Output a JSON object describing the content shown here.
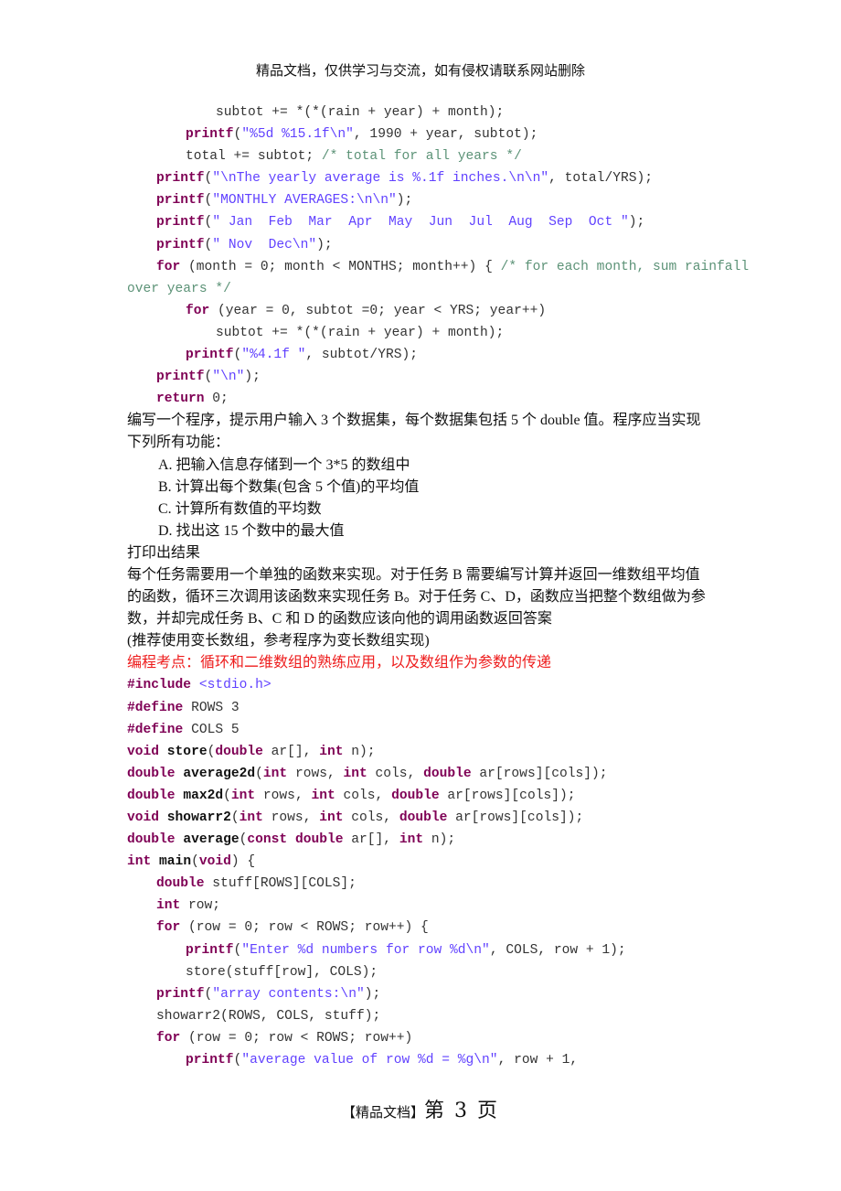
{
  "header": {
    "text": "精品文档，仅供学习与交流，如有侵权请联系网站删除"
  },
  "footer": {
    "tag": "【精品文档】",
    "page_label": "第 3 页"
  },
  "code_block_1": [
    {
      "indent": 3,
      "tokens": [
        [
          "pl",
          "subtot += *(*(rain + year) + month);"
        ]
      ]
    },
    {
      "indent": 2,
      "tokens": [
        [
          "kw",
          "printf"
        ],
        [
          "pl",
          "("
        ],
        [
          "str",
          "\"%5d %15.1f\\n\""
        ],
        [
          "pl",
          ", 1990 + year, subtot);"
        ]
      ]
    },
    {
      "indent": 2,
      "tokens": [
        [
          "pl",
          "total += subtot; "
        ],
        [
          "cm",
          "/* total for all years */"
        ]
      ]
    },
    {
      "indent": 1,
      "tokens": [
        [
          "kw",
          "printf"
        ],
        [
          "pl",
          "("
        ],
        [
          "str",
          "\"\\nThe yearly average is %.1f inches.\\n\\n\""
        ],
        [
          "pl",
          ", total/YRS);"
        ]
      ]
    },
    {
      "indent": 1,
      "tokens": [
        [
          "kw",
          "printf"
        ],
        [
          "pl",
          "("
        ],
        [
          "str",
          "\"MONTHLY AVERAGES:\\n\\n\""
        ],
        [
          "pl",
          ");"
        ]
      ]
    },
    {
      "indent": 1,
      "tokens": [
        [
          "kw",
          "printf"
        ],
        [
          "pl",
          "("
        ],
        [
          "str",
          "\" Jan  Feb  Mar  Apr  May  Jun  Jul  Aug  Sep  Oct \""
        ],
        [
          "pl",
          ");"
        ]
      ]
    },
    {
      "indent": 1,
      "tokens": [
        [
          "kw",
          "printf"
        ],
        [
          "pl",
          "("
        ],
        [
          "str",
          "\" Nov  Dec\\n\""
        ],
        [
          "pl",
          ");"
        ]
      ]
    },
    {
      "indent": 1,
      "tokens": [
        [
          "kw",
          "for"
        ],
        [
          "pl",
          " (month = 0; month < MONTHS; month++) { "
        ],
        [
          "cm",
          "/* for each month, sum rainfall"
        ]
      ]
    },
    {
      "indent": 0,
      "tokens": [
        [
          "cm",
          "over years */"
        ]
      ]
    },
    {
      "indent": 2,
      "tokens": [
        [
          "kw",
          "for"
        ],
        [
          "pl",
          " (year = 0, subtot =0; year < YRS; year++)"
        ]
      ]
    },
    {
      "indent": 3,
      "tokens": [
        [
          "pl",
          "subtot += *(*(rain + year) + month);"
        ]
      ]
    },
    {
      "indent": 2,
      "tokens": [
        [
          "kw",
          "printf"
        ],
        [
          "pl",
          "("
        ],
        [
          "str",
          "\"%4.1f \""
        ],
        [
          "pl",
          ", subtot/YRS);"
        ]
      ]
    },
    {
      "indent": 1,
      "tokens": [
        [
          "kw",
          "printf"
        ],
        [
          "pl",
          "("
        ],
        [
          "str",
          "\"\\n\""
        ],
        [
          "pl",
          ");"
        ]
      ]
    },
    {
      "indent": 1,
      "tokens": [
        [
          "kw",
          "return"
        ],
        [
          "pl",
          " 0;"
        ]
      ]
    }
  ],
  "task": {
    "intro_line1": "编写一个程序，提示用户输入 3 个数据集，每个数据集包括 5 个 double 值。程序应当实现",
    "intro_line2": "下列所有功能：",
    "items": [
      "A.   把输入信息存储到一个 3*5 的数组中",
      "B.  计算出每个数集(包含 5 个值)的平均值",
      "C.  计算所有数值的平均数",
      "D.   找出这 15 个数中的最大值"
    ],
    "print_result": "打印出结果",
    "desc_lines": [
      "每个任务需要用一个单独的函数来实现。对于任务 B 需要编写计算并返回一维数组平均值",
      "的函数，循环三次调用该函数来实现任务 B。对于任务 C、D，函数应当把整个数组做为参",
      "数，并却完成任务 B、C 和 D 的函数应该向他的调用函数返回答案",
      "(推荐使用变长数组，参考程序为变长数组实现)"
    ],
    "exam_point": "编程考点：循环和二维数组的熟练应用，以及数组作为参数的传递"
  },
  "code_block_2": [
    {
      "indent": 0,
      "tokens": [
        [
          "kw",
          "#include"
        ],
        [
          "pl",
          " "
        ],
        [
          "str",
          "<stdio.h>"
        ]
      ]
    },
    {
      "indent": 0,
      "tokens": [
        [
          "kw",
          "#define"
        ],
        [
          "pl",
          " ROWS 3"
        ]
      ]
    },
    {
      "indent": 0,
      "tokens": [
        [
          "kw",
          "#define"
        ],
        [
          "pl",
          " COLS 5"
        ]
      ]
    },
    {
      "indent": 0,
      "tokens": [
        [
          "kw",
          "void"
        ],
        [
          "pl",
          " "
        ],
        [
          "fn",
          "store"
        ],
        [
          "pl",
          "("
        ],
        [
          "kw",
          "double"
        ],
        [
          "pl",
          " ar[], "
        ],
        [
          "kw",
          "int"
        ],
        [
          "pl",
          " n);"
        ]
      ]
    },
    {
      "indent": 0,
      "tokens": [
        [
          "kw",
          "double"
        ],
        [
          "pl",
          " "
        ],
        [
          "fn",
          "average2d"
        ],
        [
          "pl",
          "("
        ],
        [
          "kw",
          "int"
        ],
        [
          "pl",
          " rows, "
        ],
        [
          "kw",
          "int"
        ],
        [
          "pl",
          " cols, "
        ],
        [
          "kw",
          "double"
        ],
        [
          "pl",
          " ar[rows][cols]);"
        ]
      ]
    },
    {
      "indent": 0,
      "tokens": [
        [
          "kw",
          "double"
        ],
        [
          "pl",
          " "
        ],
        [
          "fn",
          "max2d"
        ],
        [
          "pl",
          "("
        ],
        [
          "kw",
          "int"
        ],
        [
          "pl",
          " rows, "
        ],
        [
          "kw",
          "int"
        ],
        [
          "pl",
          " cols, "
        ],
        [
          "kw",
          "double"
        ],
        [
          "pl",
          " ar[rows][cols]);"
        ]
      ]
    },
    {
      "indent": 0,
      "tokens": [
        [
          "kw",
          "void"
        ],
        [
          "pl",
          " "
        ],
        [
          "fn",
          "showarr2"
        ],
        [
          "pl",
          "("
        ],
        [
          "kw",
          "int"
        ],
        [
          "pl",
          " rows, "
        ],
        [
          "kw",
          "int"
        ],
        [
          "pl",
          " cols, "
        ],
        [
          "kw",
          "double"
        ],
        [
          "pl",
          " ar[rows][cols]);"
        ]
      ]
    },
    {
      "indent": 0,
      "tokens": [
        [
          "kw",
          "double"
        ],
        [
          "pl",
          " "
        ],
        [
          "fn",
          "average"
        ],
        [
          "pl",
          "("
        ],
        [
          "kw",
          "const"
        ],
        [
          "pl",
          " "
        ],
        [
          "kw",
          "double"
        ],
        [
          "pl",
          " ar[], "
        ],
        [
          "kw",
          "int"
        ],
        [
          "pl",
          " n);"
        ]
      ]
    },
    {
      "indent": 0,
      "tokens": [
        [
          "kw",
          "int"
        ],
        [
          "pl",
          " "
        ],
        [
          "fn",
          "main"
        ],
        [
          "pl",
          "("
        ],
        [
          "kw",
          "void"
        ],
        [
          "pl",
          ") {"
        ]
      ]
    },
    {
      "indent": 1,
      "tokens": [
        [
          "kw",
          "double"
        ],
        [
          "pl",
          " stuff[ROWS][COLS];"
        ]
      ]
    },
    {
      "indent": 1,
      "tokens": [
        [
          "kw",
          "int"
        ],
        [
          "pl",
          " row;"
        ]
      ]
    },
    {
      "indent": 1,
      "tokens": [
        [
          "kw",
          "for"
        ],
        [
          "pl",
          " (row = 0; row < ROWS; row++) {"
        ]
      ]
    },
    {
      "indent": 2,
      "tokens": [
        [
          "kw",
          "printf"
        ],
        [
          "pl",
          "("
        ],
        [
          "str",
          "\"Enter %d numbers for row %d\\n\""
        ],
        [
          "pl",
          ", COLS, row + 1);"
        ]
      ]
    },
    {
      "indent": 2,
      "tokens": [
        [
          "pl",
          "store(stuff[row], COLS);"
        ]
      ]
    },
    {
      "indent": 1,
      "tokens": [
        [
          "kw",
          "printf"
        ],
        [
          "pl",
          "("
        ],
        [
          "str",
          "\"array contents:\\n\""
        ],
        [
          "pl",
          ");"
        ]
      ]
    },
    {
      "indent": 1,
      "tokens": [
        [
          "pl",
          "showarr2(ROWS, COLS, stuff);"
        ]
      ]
    },
    {
      "indent": 1,
      "tokens": [
        [
          "kw",
          "for"
        ],
        [
          "pl",
          " (row = 0; row < ROWS; row++)"
        ]
      ]
    },
    {
      "indent": 2,
      "tokens": [
        [
          "kw",
          "printf"
        ],
        [
          "pl",
          "("
        ],
        [
          "str",
          "\"average value of row %d = %g\\n\""
        ],
        [
          "pl",
          ", row + 1,"
        ]
      ]
    }
  ],
  "colors": {
    "keyword": "#7f0055",
    "string": "#2a00ff",
    "comment": "#3f7f5f",
    "plain": "#333333",
    "exam_point": "#ee1c1c"
  }
}
